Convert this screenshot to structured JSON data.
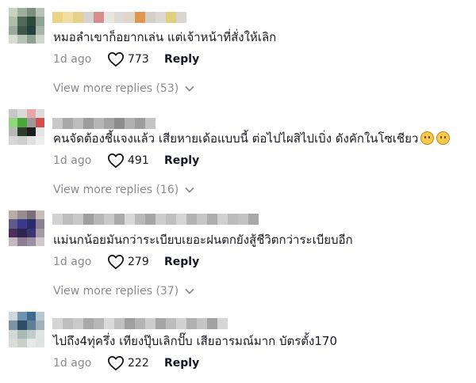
{
  "comments": [
    {
      "text": "หมอลำเขาก็อยากเล่น แต่เจ้าหน้าที่สั่งให้เลิก",
      "time": "1d ago",
      "likes": "773",
      "reply_label": "Reply",
      "more_label": "View more replies (53)",
      "avatar_colors": [
        "#c9d4c0",
        "#9fb09a",
        "#7c8f7f",
        "#b8c4b4",
        "#aebfa8",
        "#4f6a58",
        "#2e4a3a",
        "#8fa394",
        "#9aa89e",
        "#3d5a48",
        "#24403a",
        "#a6b5a9",
        "#d6dcd2",
        "#b6c2b4",
        "#8da090",
        "#cfd6cc"
      ],
      "username_colors": [
        "#e8d58a",
        "#f0dfa0",
        "#e7cf8c",
        "#d5d3d0",
        "#d88c8c",
        "#e8e4e0",
        "#dedad6",
        "#e0d6c8",
        "#e0964e",
        "#d3cfc9",
        "#dcd8d2",
        "#e2cf7c",
        "#d9d6d2"
      ]
    },
    {
      "text": "คนจัดต้องชี้แจงแล้ว เสียหายเด้อแบบนี้ ต่อไปไผสิไปเบิ่ง ดังคักในโซเชียว",
      "time": "1d ago",
      "likes": "491",
      "reply_label": "Reply",
      "more_label": "View more replies (16)",
      "avatar_colors": [
        "#c7c7c7",
        "#d9d9d9",
        "#e6a6a6",
        "#dcdcdc",
        "#8fd67c",
        "#4aa83a",
        "#9a9a9a",
        "#d34f4f",
        "#b8b8b8",
        "#2f3b2f",
        "#1c1c1c",
        "#e4e4e4",
        "#d6d6d6",
        "#cfcfcf",
        "#e0e0e0",
        "#eeeeee"
      ],
      "username_colors": [
        "#c9c9c9",
        "#a9a9a9",
        "#bdbdbd",
        "#9c9c9c",
        "#b5b5b5",
        "#a3a3a3",
        "#8c8c8c",
        "#b0b0b0",
        "#9e9e9e",
        "#c4c4c4"
      ]
    },
    {
      "text": "แม่นกน้อยมันกว่าระเบียบเยอะฝนตกยังสู้ชีวิตกว่าระเบียบอีก",
      "time": "1d ago",
      "likes": "279",
      "reply_label": "Reply",
      "more_label": "View more replies (37)",
      "avatar_colors": [
        "#b9aba6",
        "#9a8b90",
        "#7d6f7a",
        "#c9bcb8",
        "#5f5a8a",
        "#3a3a88",
        "#2b2a6a",
        "#8a7f92",
        "#4c2e5e",
        "#2d2550",
        "#3b3470",
        "#a597a6",
        "#c4b9c0",
        "#8f7d92",
        "#9b8fa3",
        "#d2c8cc"
      ],
      "username_colors": [
        "#d2d2d2",
        "#bdbdbd",
        "#c8c8c8",
        "#9f9f9f",
        "#b7b7b7",
        "#c9c9c9",
        "#aaaaaa",
        "#d8d8d8",
        "#b9b9b9",
        "#a6a6a6",
        "#cdcdcd",
        "#bfbfbf",
        "#d4d4d4",
        "#b3b3b3",
        "#c6c6c6",
        "#aeaeae",
        "#d0d0d0",
        "#bcbcbc",
        "#c2c2c2",
        "#a8a8a8"
      ]
    },
    {
      "text": "ไปถึง4ทุ่ครึ่ง เทียงปุ๊บเลิกปั๊บ เสียอารมณ์มาก บัตรตั้ง170",
      "time": "1d ago",
      "likes": "222",
      "reply_label": "Reply",
      "more_label": "",
      "avatar_colors": [
        "#cfd7dc",
        "#6d93b0",
        "#3d6a8f",
        "#b8c6cf",
        "#7f94a2",
        "#2f4e66",
        "#5e7f96",
        "#9fb1bd",
        "#d2d8d6",
        "#aab9b4",
        "#c1ccc8",
        "#e0e4e2",
        "#d9dedb",
        "#c9d0cc",
        "#e6e9e7",
        "#dfe3e1"
      ],
      "username_colors": [
        "#d4d4d4",
        "#bfbfbf",
        "#cacaca",
        "#a9a9a9",
        "#b7b7b7",
        "#dadada",
        "#c0c0c0",
        "#9f9f9f",
        "#b4b4b4",
        "#cdcdcd",
        "#a6a6a6",
        "#bcbcbc",
        "#d1d1d1",
        "#b0b0b0",
        "#c5c5c5",
        "#a2a2a2",
        "#d6d6d6"
      ]
    }
  ],
  "comment2_emoji": [
    "face-emoji",
    "face-emoji"
  ]
}
